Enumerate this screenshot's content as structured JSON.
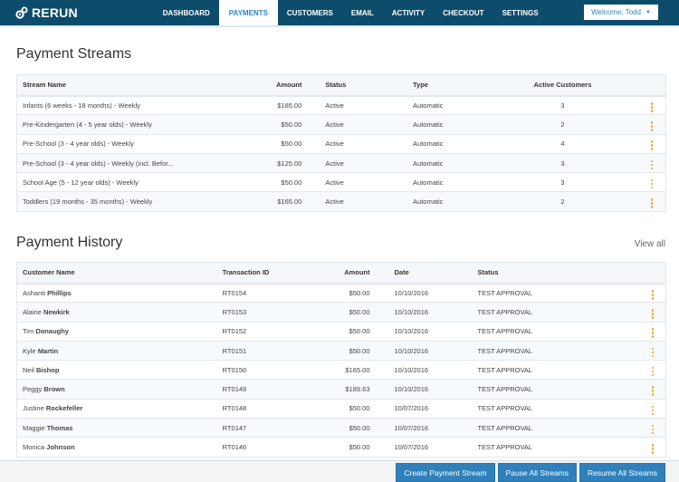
{
  "app": {
    "brand": "RERUN",
    "logo_icon": "gear-link-icon"
  },
  "nav": {
    "tabs": [
      {
        "label": "DASHBOARD",
        "active": false
      },
      {
        "label": "PAYMENTS",
        "active": true
      },
      {
        "label": "CUSTOMERS",
        "active": false
      },
      {
        "label": "EMAIL",
        "active": false
      },
      {
        "label": "ACTIVITY",
        "active": false
      },
      {
        "label": "CHECKOUT",
        "active": false
      },
      {
        "label": "SETTINGS",
        "active": false
      }
    ],
    "user_menu": {
      "label": "Welcome, Todd",
      "icon": "caret-down-icon"
    }
  },
  "colors": {
    "navbar": "#0d4d6b",
    "accent": "#2f86c0",
    "kebab": "#f0a132",
    "button": "#2f80bb"
  },
  "payment_streams": {
    "title": "Payment Streams",
    "columns": [
      "Stream Name",
      "Amount",
      "Status",
      "Type",
      "Active Customers"
    ],
    "rows": [
      {
        "name": "Infants (6 weeks - 18 months) - Weekly",
        "amount": "$185.00",
        "status": "Active",
        "type": "Automatic",
        "active_customers": "3"
      },
      {
        "name": "Pre-Kindergarten (4 - 5 year olds) - Weekly",
        "amount": "$50.00",
        "status": "Active",
        "type": "Automatic",
        "active_customers": "2"
      },
      {
        "name": "Pre-School (3 - 4 year olds) - Weekly",
        "amount": "$50.00",
        "status": "Active",
        "type": "Automatic",
        "active_customers": "4"
      },
      {
        "name": "Pre-School (3 - 4 year olds) - Weekly (incl. Befor...",
        "amount": "$125.00",
        "status": "Active",
        "type": "Automatic",
        "active_customers": "3"
      },
      {
        "name": "School Age (5 - 12 year olds) - Weekly",
        "amount": "$50.00",
        "status": "Active",
        "type": "Automatic",
        "active_customers": "3"
      },
      {
        "name": "Toddlers (19 months - 35 months) - Weekly",
        "amount": "$165.00",
        "status": "Active",
        "type": "Automatic",
        "active_customers": "2"
      }
    ]
  },
  "payment_history": {
    "title": "Payment History",
    "view_all": "View all",
    "columns": [
      "Customer Name",
      "Transaction ID",
      "Amount",
      "Date",
      "Status"
    ],
    "rows": [
      {
        "first": "Ashanti",
        "last": "Phillips",
        "txn": "RT0154",
        "amount": "$50.00",
        "date": "10/10/2016",
        "status": "TEST APPROVAL"
      },
      {
        "first": "Alaine",
        "last": "Newkirk",
        "txn": "RT0153",
        "amount": "$50.00",
        "date": "10/10/2016",
        "status": "TEST APPROVAL"
      },
      {
        "first": "Tim",
        "last": "Donaughy",
        "txn": "RT0152",
        "amount": "$50.00",
        "date": "10/10/2016",
        "status": "TEST APPROVAL"
      },
      {
        "first": "Kyle",
        "last": "Martin",
        "txn": "RT0151",
        "amount": "$50.00",
        "date": "10/10/2016",
        "status": "TEST APPROVAL"
      },
      {
        "first": "Neil",
        "last": "Bishop",
        "txn": "RT0150",
        "amount": "$165.00",
        "date": "10/10/2016",
        "status": "TEST APPROVAL"
      },
      {
        "first": "Peggy",
        "last": "Brown",
        "txn": "RT0149",
        "amount": "$189.63",
        "date": "10/10/2016",
        "status": "TEST APPROVAL"
      },
      {
        "first": "Justine",
        "last": "Rockefeller",
        "txn": "RT0148",
        "amount": "$50.00",
        "date": "10/07/2016",
        "status": "TEST APPROVAL"
      },
      {
        "first": "Maggie",
        "last": "Thomas",
        "txn": "RT0147",
        "amount": "$50.00",
        "date": "10/07/2016",
        "status": "TEST APPROVAL"
      },
      {
        "first": "Monica",
        "last": "Johnson",
        "txn": "RT0146",
        "amount": "$50.00",
        "date": "10/07/2016",
        "status": "TEST APPROVAL"
      }
    ]
  },
  "actions": {
    "create": "Create Payment Stream",
    "pause": "Pause All Streams",
    "resume": "Resume All Streams"
  }
}
